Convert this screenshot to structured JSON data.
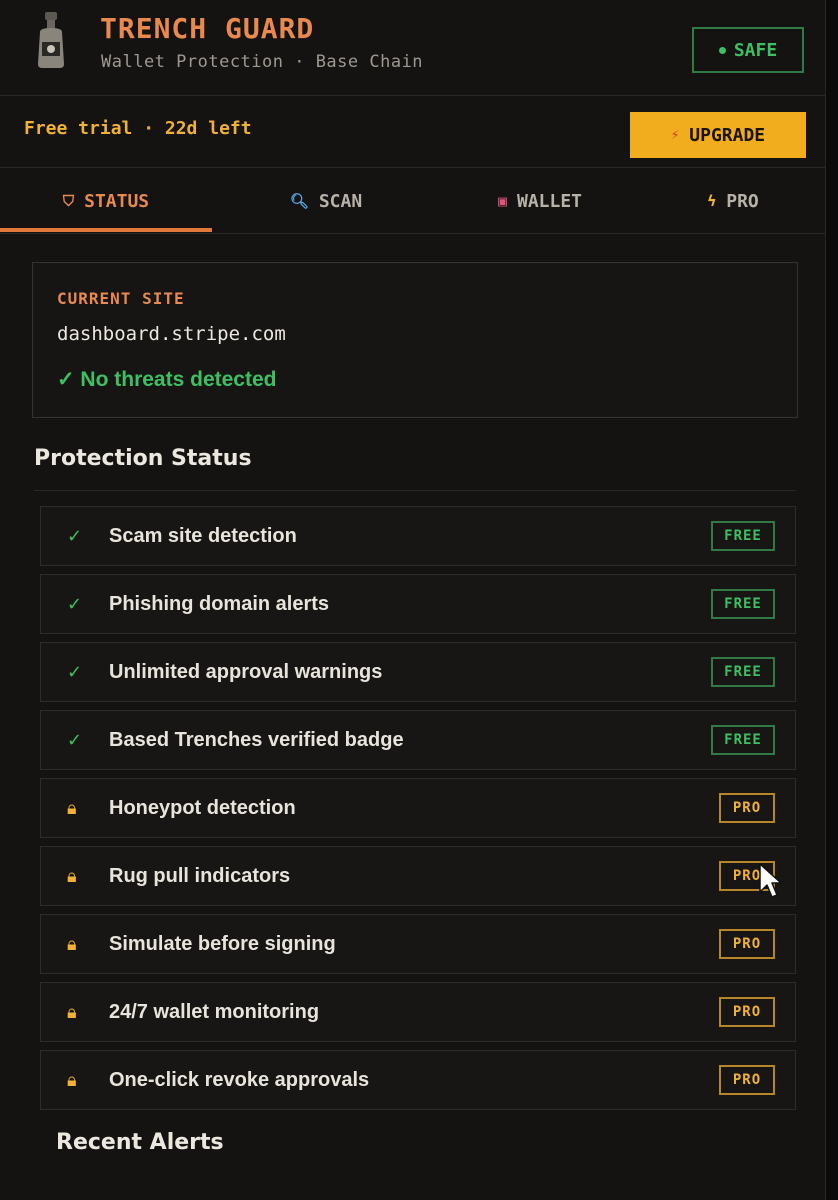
{
  "header": {
    "title": "TRENCH GUARD",
    "subtitle": "Wallet Protection · Base Chain",
    "status_badge": "SAFE",
    "logo_icon": "bottle-icon"
  },
  "trial": {
    "text": "Free trial · 22d left",
    "upgrade_label": "UPGRADE"
  },
  "tabs": [
    {
      "label": "STATUS",
      "icon": "shield-icon",
      "active": true
    },
    {
      "label": "SCAN",
      "icon": "magnifier-icon",
      "active": false
    },
    {
      "label": "WALLET",
      "icon": "wallet-icon",
      "active": false
    },
    {
      "label": "PRO",
      "icon": "bolt-icon",
      "active": false
    }
  ],
  "current_site": {
    "label": "CURRENT SITE",
    "url": "dashboard.stripe.com",
    "status": "✓ No threats detected"
  },
  "protection": {
    "title": "Protection Status",
    "features": [
      {
        "label": "Scam site detection",
        "tier": "FREE",
        "enabled": true
      },
      {
        "label": "Phishing domain alerts",
        "tier": "FREE",
        "enabled": true
      },
      {
        "label": "Unlimited approval warnings",
        "tier": "FREE",
        "enabled": true
      },
      {
        "label": "Based Trenches verified badge",
        "tier": "FREE",
        "enabled": true
      },
      {
        "label": "Honeypot detection",
        "tier": "PRO",
        "enabled": false
      },
      {
        "label": "Rug pull indicators",
        "tier": "PRO",
        "enabled": false
      },
      {
        "label": "Simulate before signing",
        "tier": "PRO",
        "enabled": false
      },
      {
        "label": "24/7 wallet monitoring",
        "tier": "PRO",
        "enabled": false
      },
      {
        "label": "One-click revoke approvals",
        "tier": "PRO",
        "enabled": false
      }
    ]
  },
  "alerts": {
    "title": "Recent Alerts"
  },
  "colors": {
    "accent_orange": "#e8894f",
    "accent_yellow": "#f2ad1e",
    "safe_green": "#3fbf63",
    "background": "#141312"
  }
}
